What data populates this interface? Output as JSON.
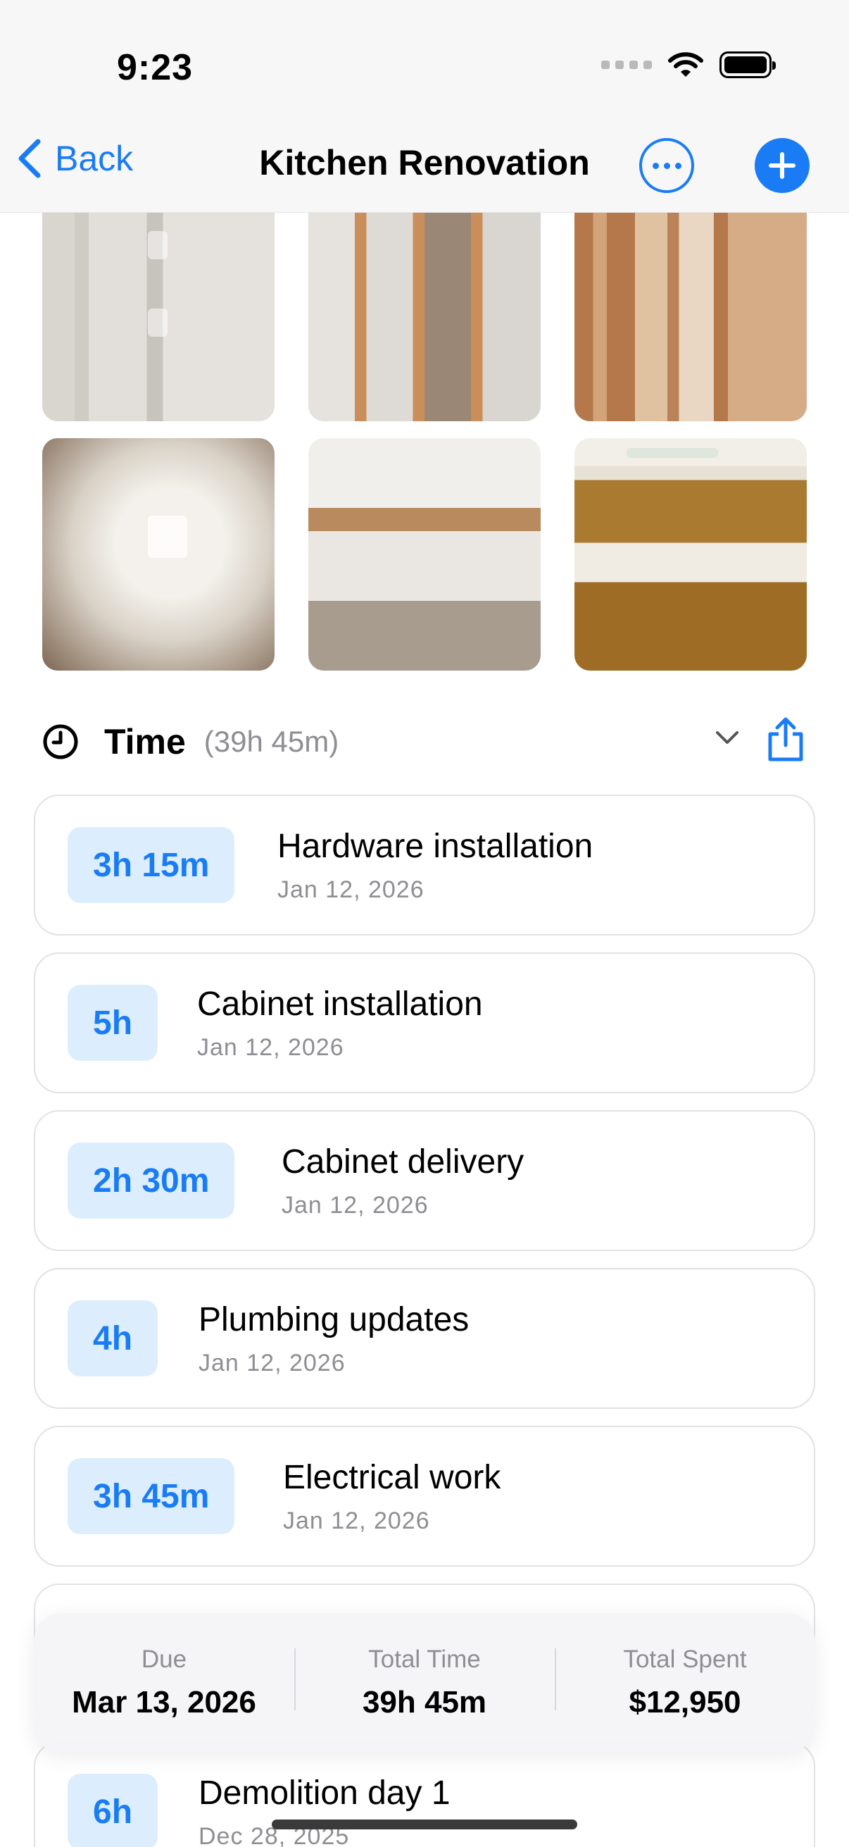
{
  "status": {
    "time": "9:23"
  },
  "nav": {
    "back_label": "Back",
    "title": "Kitchen Renovation"
  },
  "icons": {
    "back": "chevron-left-icon",
    "more": "ellipsis-circle-icon",
    "add": "plus-circle-icon",
    "clock": "clock-icon",
    "collapse": "chevron-down-icon",
    "share": "share-icon"
  },
  "colors": {
    "accent": "#1a7cf5",
    "badge_bg": "#dceefd",
    "muted": "#8e8e93"
  },
  "time_section": {
    "title": "Time",
    "total": "(39h 45m)"
  },
  "entries": [
    {
      "duration": "3h 15m",
      "title": "Hardware installation",
      "date": "Jan 12, 2026"
    },
    {
      "duration": "5h",
      "title": "Cabinet installation",
      "date": "Jan 12, 2026"
    },
    {
      "duration": "2h 30m",
      "title": "Cabinet delivery",
      "date": "Jan 12, 2026"
    },
    {
      "duration": "4h",
      "title": "Plumbing updates",
      "date": "Jan 12, 2026"
    },
    {
      "duration": "3h 45m",
      "title": "Electrical work",
      "date": "Jan 12, 2026"
    },
    {
      "duration": "6h",
      "title": "Demolition day 1",
      "date": "Dec 28, 2025"
    }
  ],
  "summary": {
    "due_label": "Due",
    "due_value": "Mar 13, 2026",
    "time_label": "Total Time",
    "time_value": "39h 45m",
    "spent_label": "Total Spent",
    "spent_value": "$12,950"
  }
}
